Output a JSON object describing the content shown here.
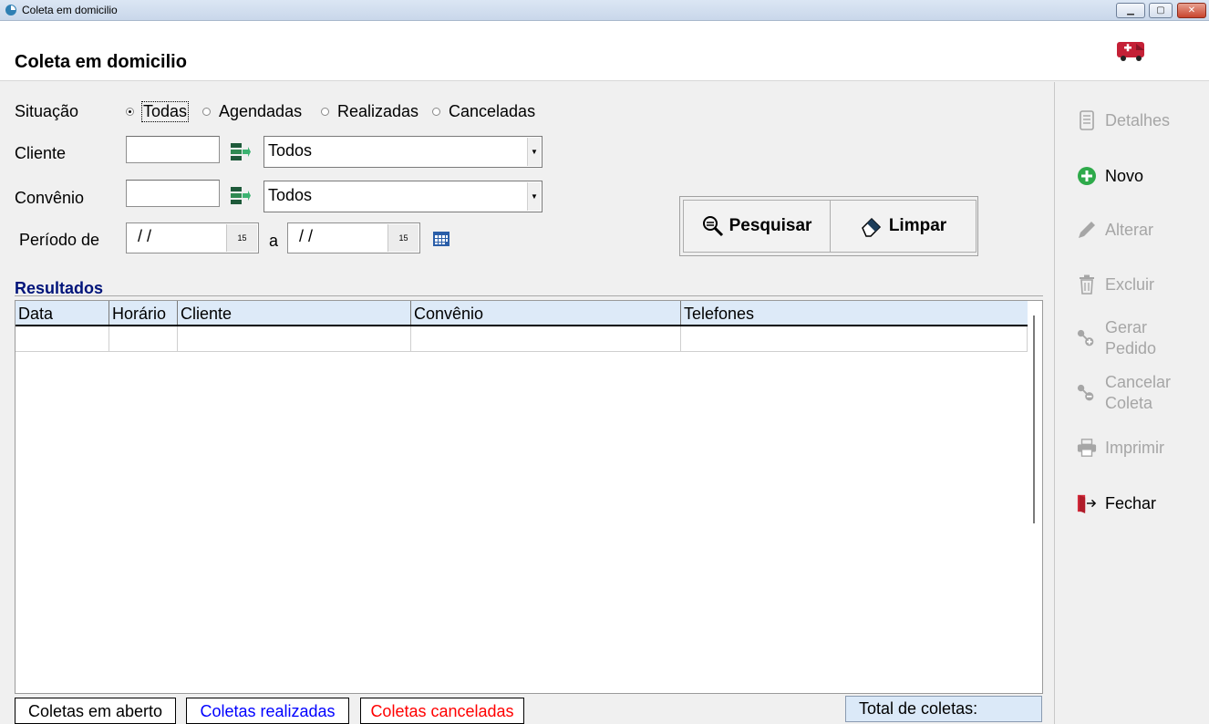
{
  "window": {
    "title": "Coleta em domicilio",
    "controls": [
      "minimize",
      "maximize",
      "close"
    ]
  },
  "header": {
    "page_title": "Coleta em domicilio",
    "icon": "ambulance-icon"
  },
  "filters": {
    "situacao_label": "Situação",
    "situacao_options": [
      "Todas",
      "Agendadas",
      "Realizadas",
      "Canceladas"
    ],
    "situacao_selected": "Todas",
    "cliente_label": "Cliente",
    "cliente_code": "",
    "cliente_select": "Todos",
    "convenio_label": "Convênio",
    "convenio_code": "",
    "convenio_select": "Todos",
    "periodo_label": "Período de",
    "periodo_from": "/ /",
    "periodo_sep": "a",
    "periodo_to": "/ /"
  },
  "actions": {
    "pesquisar": "Pesquisar",
    "limpar": "Limpar"
  },
  "results": {
    "section_title": "Resultados",
    "columns": [
      "Data",
      "Horário",
      "Cliente",
      "Convênio",
      "Telefones"
    ],
    "rows": []
  },
  "legend": {
    "aberto": "Coletas em aberto",
    "realizadas": "Coletas realizadas",
    "canceladas": "Coletas canceladas",
    "total_label": "Total de coletas:",
    "colors": {
      "aberto": "#000000",
      "realizadas": "#0000ff",
      "canceladas": "#ff0000"
    }
  },
  "sidebar": {
    "detalhes": "Detalhes",
    "novo": "Novo",
    "alterar": "Alterar",
    "excluir": "Excluir",
    "gerar_line1": "Gerar",
    "gerar_line2": "Pedido",
    "cancelar_line1": "Cancelar",
    "cancelar_line2": "Coleta",
    "imprimir": "Imprimir",
    "fechar": "Fechar"
  }
}
